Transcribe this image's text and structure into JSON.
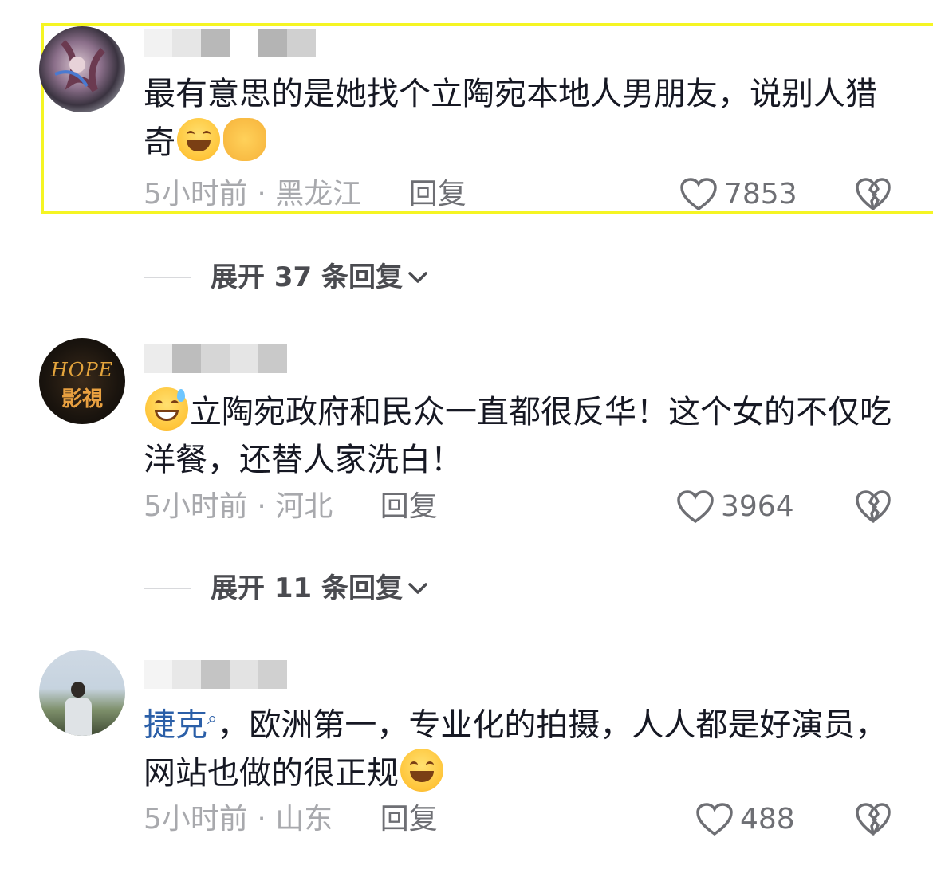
{
  "comments": [
    {
      "content_text": "最有意思的是她找个立陶宛本地人男朋友，说别人猎奇",
      "time_region": "5小时前 · 黑龙江",
      "reply_label": "回复",
      "likes": "7853",
      "highlighted": true,
      "emojis": [
        "laughing-tears-emoji",
        "ok-hand-emoji"
      ]
    },
    {
      "content_text": "立陶宛政府和民众一直都很反华！这个女的不仅吃洋餐，还替人家洗白！",
      "time_region": "5小时前 · 河北",
      "reply_label": "回复",
      "likes": "3964",
      "emojis": [
        "grin-sweat-emoji"
      ],
      "avatar_text": {
        "line1": "HOPE",
        "line2": "影視"
      }
    },
    {
      "link_text": "捷克",
      "content_text": "，欧洲第一，专业化的拍摄，人人都是好演员，网站也做的很正规",
      "time_region": "5小时前 · 山东",
      "reply_label": "回复",
      "likes": "488",
      "emojis": [
        "laughing-tears-emoji"
      ]
    }
  ],
  "expand_rows": [
    {
      "label": "展开 37 条回复"
    },
    {
      "label": "展开 11 条回复"
    }
  ],
  "colors": {
    "highlight_border": "#f5f523",
    "link": "#2b5fa8",
    "meta_text": "#a8a9ad",
    "main_text": "#161823"
  },
  "icons": {
    "like": "heart-outline-icon",
    "dislike": "broken-heart-icon",
    "expand": "chevron-down-icon",
    "search": "search-icon"
  }
}
